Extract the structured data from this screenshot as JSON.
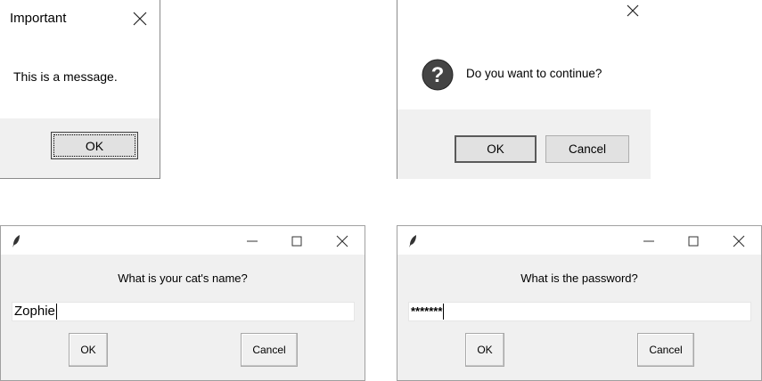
{
  "dialog_info": {
    "title": "Important",
    "message": "This is a message.",
    "ok_label": "OK",
    "close_icon": "close-icon"
  },
  "dialog_question": {
    "message": "Do you want to continue?",
    "ok_label": "OK",
    "cancel_label": "Cancel",
    "icon": "question-icon",
    "close_icon": "close-icon"
  },
  "dialog_name": {
    "prompt": "What is your cat's name?",
    "entry_value": "Zophie",
    "ok_label": "OK",
    "cancel_label": "Cancel",
    "app_icon": "feather-icon"
  },
  "dialog_password": {
    "prompt": "What is the password?",
    "entry_value": "*******",
    "ok_label": "OK",
    "cancel_label": "Cancel",
    "app_icon": "feather-icon"
  }
}
